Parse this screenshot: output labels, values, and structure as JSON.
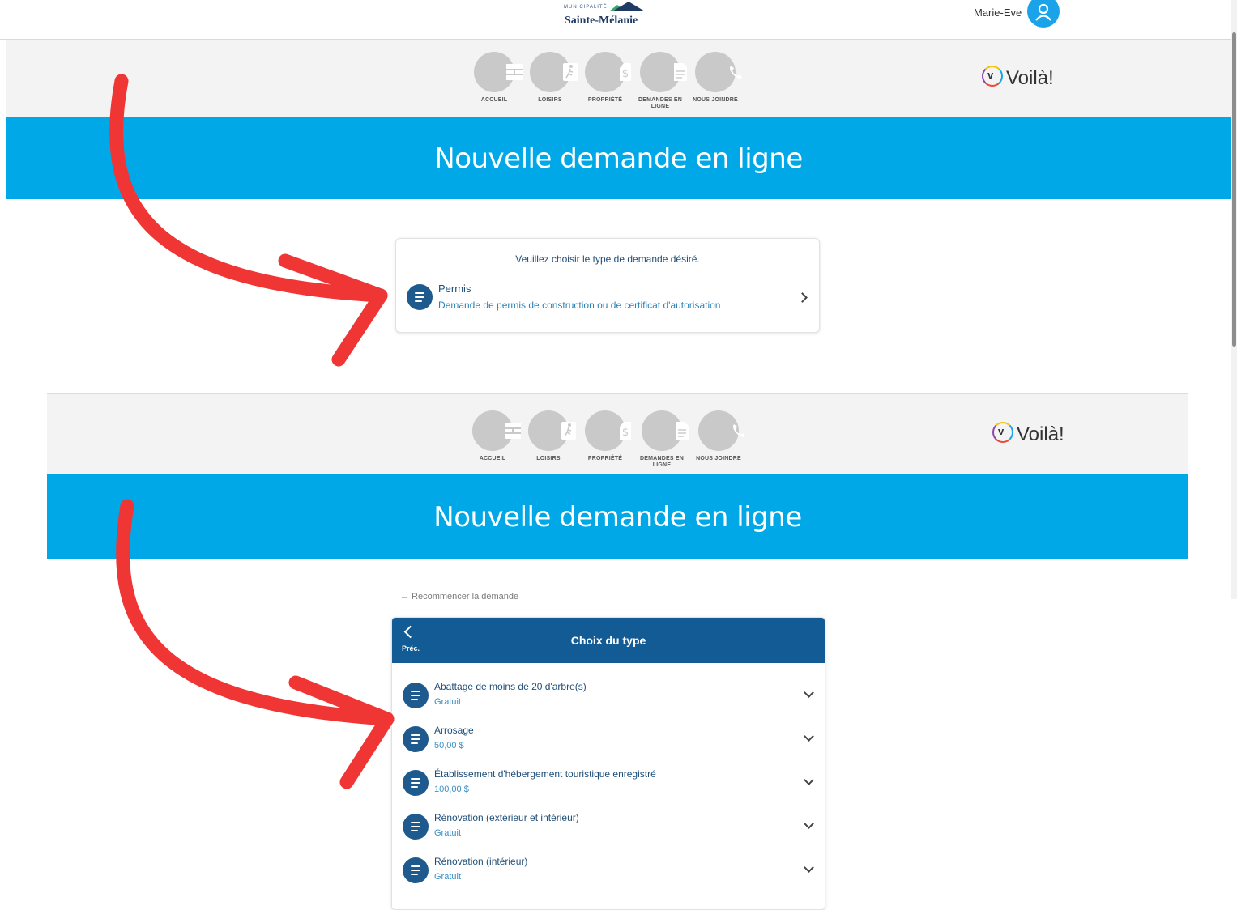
{
  "header": {
    "municipality_small": "MUNICIPALITÉ",
    "municipality_name": "Sainte-Mélanie",
    "user_name": "Marie-Eve"
  },
  "nav": {
    "items": [
      {
        "label": "ACCUEIL",
        "icon": "home-grid-icon"
      },
      {
        "label": "LOISIRS",
        "icon": "runner-icon"
      },
      {
        "label": "PROPRIÉTÉ",
        "icon": "dollar-tag-icon"
      },
      {
        "label": "DEMANDES EN LIGNE",
        "icon": "document-icon"
      },
      {
        "label": "NOUS JOINDRE",
        "icon": "phone-icon"
      }
    ],
    "brand": "Voilà!",
    "brand_mark": "v"
  },
  "banner": {
    "title": "Nouvelle demande en ligne"
  },
  "step1": {
    "prompt": "Veuillez choisir le type de demande désiré.",
    "item": {
      "title": "Permis",
      "subtitle": "Demande de permis de construction ou de certificat d'autorisation"
    }
  },
  "step2": {
    "restart_label": "← Recommencer la demande",
    "back_label": "Préc.",
    "title": "Choix du type",
    "items": [
      {
        "title": "Abattage de moins de 20 d'arbre(s)",
        "price": "Gratuit"
      },
      {
        "title": "Arrosage",
        "price": "50,00 $"
      },
      {
        "title": "Établissement d'hébergement touristique enregistré",
        "price": "100,00 $"
      },
      {
        "title": "Rénovation (extérieur et intérieur)",
        "price": "Gratuit"
      },
      {
        "title": "Rénovation (intérieur)",
        "price": "Gratuit"
      }
    ]
  },
  "colors": {
    "banner_blue": "#00a8e8",
    "card_header_blue": "#135b94",
    "icon_blue": "#1e5a8e",
    "arrow_red": "#f03535"
  }
}
